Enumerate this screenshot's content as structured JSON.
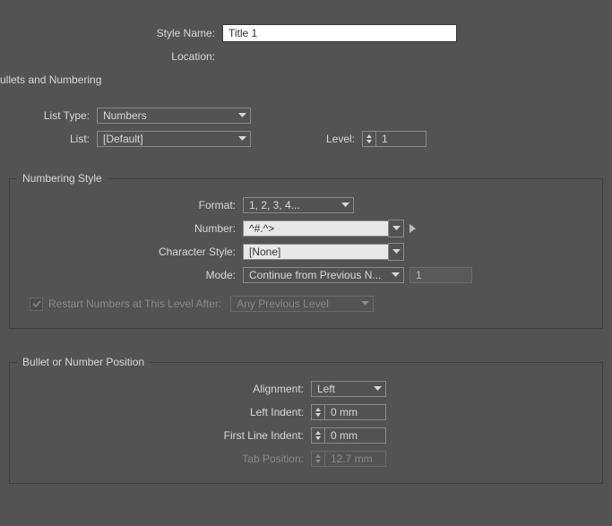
{
  "header": {
    "style_name_label": "Style Name:",
    "style_name_value": "Title 1",
    "location_label": "Location:"
  },
  "section_title": "ullets and Numbering",
  "list_type": {
    "label": "List Type:",
    "value": "Numbers"
  },
  "list": {
    "label": "List:",
    "value": "[Default]"
  },
  "level": {
    "label": "Level:",
    "value": "1"
  },
  "numbering_style": {
    "legend": "Numbering Style",
    "format": {
      "label": "Format:",
      "value": "1, 2, 3, 4..."
    },
    "number": {
      "label": "Number:",
      "value": "^#.^>"
    },
    "character_style": {
      "label": "Character Style:",
      "value": "[None]"
    },
    "mode": {
      "label": "Mode:",
      "value": "Continue from Previous N...",
      "start": "1"
    },
    "restart": {
      "label": "Restart Numbers at This Level After:",
      "value": "Any Previous Level",
      "checked": true
    }
  },
  "position": {
    "legend": "Bullet or Number Position",
    "alignment": {
      "label": "Alignment:",
      "value": "Left"
    },
    "left_indent": {
      "label": "Left Indent:",
      "value": "0 mm"
    },
    "first_line": {
      "label": "First Line Indent:",
      "value": "0 mm"
    },
    "tab": {
      "label": "Tab Position:",
      "value": "12.7 mm"
    }
  }
}
